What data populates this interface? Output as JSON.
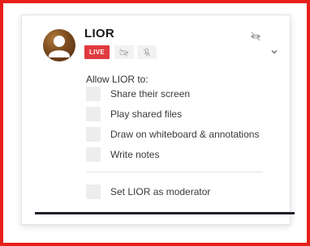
{
  "participant": {
    "name": "LIOR",
    "live_badge": "LIVE"
  },
  "icons": {
    "avatar": "user-avatar-icon",
    "video": "video-off-icon",
    "mic": "mic-off-icon",
    "visibility": "eye-off-icon",
    "expand": "chevron-down-icon"
  },
  "permissions": {
    "heading": "Allow LIOR to:",
    "items": [
      {
        "label": "Share their screen",
        "checked": false
      },
      {
        "label": "Play shared files",
        "checked": false
      },
      {
        "label": "Draw on whiteboard & annotations",
        "checked": false
      },
      {
        "label": "Write notes",
        "checked": false
      }
    ],
    "moderator": {
      "label": "Set LIOR as moderator",
      "checked": false
    }
  },
  "colors": {
    "frame_border": "#e8201b",
    "live_badge": "#e03a3f",
    "checkbox": "#ededed",
    "bottom_line": "#1e1e2a"
  }
}
